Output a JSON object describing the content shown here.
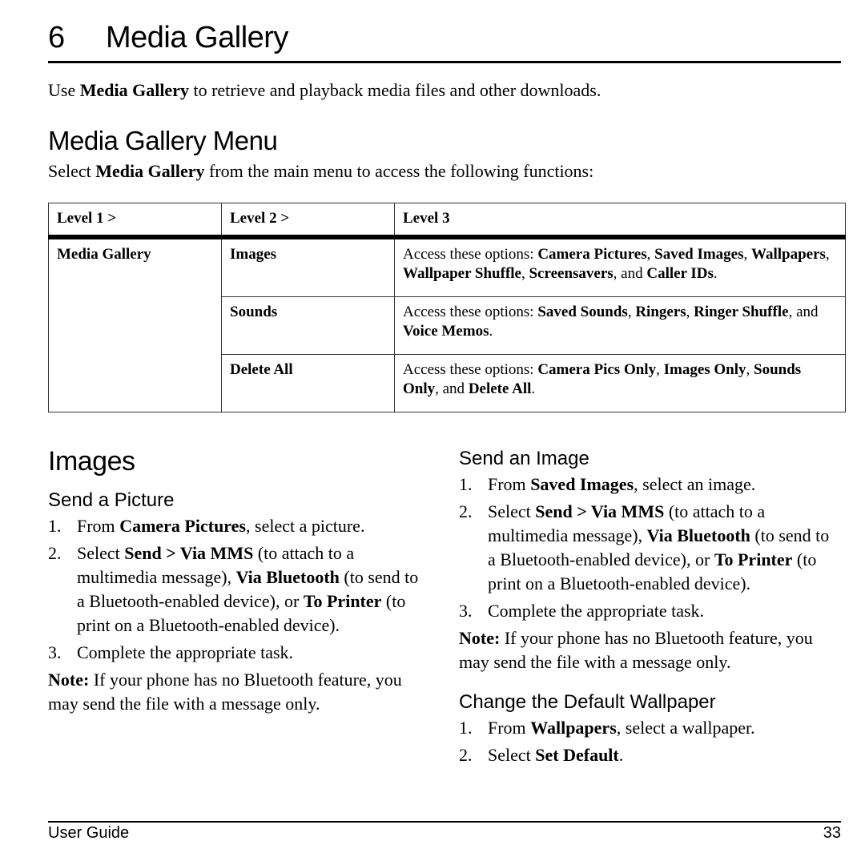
{
  "chapter": {
    "number": "6",
    "title": "Media Gallery"
  },
  "intro": {
    "pre": "Use ",
    "bold": "Media Gallery",
    "post": " to retrieve and playback media files and other downloads."
  },
  "menu_section": {
    "heading": "Media Gallery Menu",
    "intro": {
      "pre": "Select ",
      "bold": "Media Gallery",
      "post": " from the main menu to access the following functions:"
    }
  },
  "menu_table": {
    "headers": [
      "Level 1 >",
      "Level 2 >",
      "Level 3"
    ],
    "level1": "Media Gallery",
    "rows": [
      {
        "level2": "Images",
        "level3": [
          {
            "t": "Access these options: ",
            "b": false
          },
          {
            "t": "Camera Pictures",
            "b": true
          },
          {
            "t": ", ",
            "b": false
          },
          {
            "t": "Saved Images",
            "b": true
          },
          {
            "t": ", ",
            "b": false
          },
          {
            "t": "Wallpapers",
            "b": true
          },
          {
            "t": ", ",
            "b": false
          },
          {
            "t": "Wallpaper Shuffle",
            "b": true
          },
          {
            "t": ", ",
            "b": false
          },
          {
            "t": "Screensavers",
            "b": true
          },
          {
            "t": ", and ",
            "b": false
          },
          {
            "t": "Caller IDs",
            "b": true
          },
          {
            "t": ".",
            "b": false
          }
        ]
      },
      {
        "level2": "Sounds",
        "level3": [
          {
            "t": "Access these options: ",
            "b": false
          },
          {
            "t": "Saved Sounds",
            "b": true
          },
          {
            "t": ", ",
            "b": false
          },
          {
            "t": "Ringers",
            "b": true
          },
          {
            "t": ", ",
            "b": false
          },
          {
            "t": "Ringer Shuffle",
            "b": true
          },
          {
            "t": ", and ",
            "b": false
          },
          {
            "t": "Voice Memos",
            "b": true
          },
          {
            "t": ".",
            "b": false
          }
        ]
      },
      {
        "level2": "Delete All",
        "level3": [
          {
            "t": "Access these options: ",
            "b": false
          },
          {
            "t": "Camera Pics Only",
            "b": true
          },
          {
            "t": ", ",
            "b": false
          },
          {
            "t": "Images Only",
            "b": true
          },
          {
            "t": ", ",
            "b": false
          },
          {
            "t": "Sounds Only",
            "b": true
          },
          {
            "t": ", and ",
            "b": false
          },
          {
            "t": "Delete All",
            "b": true
          },
          {
            "t": ".",
            "b": false
          }
        ]
      }
    ]
  },
  "images_section": {
    "heading": "Images",
    "send_picture": {
      "heading": "Send a Picture",
      "steps": [
        {
          "n": "1.",
          "parts": [
            {
              "t": "From ",
              "b": false
            },
            {
              "t": "Camera Pictures",
              "b": true
            },
            {
              "t": ", select a picture.",
              "b": false
            }
          ]
        },
        {
          "n": "2.",
          "parts": [
            {
              "t": "Select ",
              "b": false
            },
            {
              "t": "Send > Via MMS",
              "b": true
            },
            {
              "t": " (to attach to a multimedia message), ",
              "b": false
            },
            {
              "t": "Via Bluetooth",
              "b": true
            },
            {
              "t": " (to send to a Bluetooth-enabled device), or ",
              "b": false
            },
            {
              "t": "To Printer",
              "b": true
            },
            {
              "t": " (to print on a Bluetooth-enabled device).",
              "b": false
            }
          ]
        },
        {
          "n": "3.",
          "parts": [
            {
              "t": "Complete the appropriate task.",
              "b": false
            }
          ]
        }
      ],
      "note": {
        "label": "Note:",
        "text": " If your phone has no Bluetooth feature, you may send the file with a message only."
      }
    },
    "send_image": {
      "heading": "Send an Image",
      "steps": [
        {
          "n": "1.",
          "parts": [
            {
              "t": "From ",
              "b": false
            },
            {
              "t": "Saved Images",
              "b": true
            },
            {
              "t": ", select an image.",
              "b": false
            }
          ]
        },
        {
          "n": "2.",
          "parts": [
            {
              "t": "Select ",
              "b": false
            },
            {
              "t": "Send > Via MMS",
              "b": true
            },
            {
              "t": " (to attach to a multimedia message), ",
              "b": false
            },
            {
              "t": "Via Bluetooth",
              "b": true
            },
            {
              "t": " (to send to a Bluetooth-enabled device), or ",
              "b": false
            },
            {
              "t": "To Printer",
              "b": true
            },
            {
              "t": " (to print on a Bluetooth-enabled device).",
              "b": false
            }
          ]
        },
        {
          "n": "3.",
          "parts": [
            {
              "t": "Complete the appropriate task.",
              "b": false
            }
          ]
        }
      ],
      "note": {
        "label": "Note:",
        "text": " If your phone has no Bluetooth feature, you may send the file with a message only."
      }
    },
    "default_wallpaper": {
      "heading": "Change the Default Wallpaper",
      "steps": [
        {
          "n": "1.",
          "parts": [
            {
              "t": "From ",
              "b": false
            },
            {
              "t": "Wallpapers",
              "b": true
            },
            {
              "t": ", select a wallpaper.",
              "b": false
            }
          ]
        },
        {
          "n": "2.",
          "parts": [
            {
              "t": "Select ",
              "b": false
            },
            {
              "t": "Set Default",
              "b": true
            },
            {
              "t": ".",
              "b": false
            }
          ]
        }
      ]
    }
  },
  "footer": {
    "left": "User Guide",
    "page_number": "33"
  }
}
